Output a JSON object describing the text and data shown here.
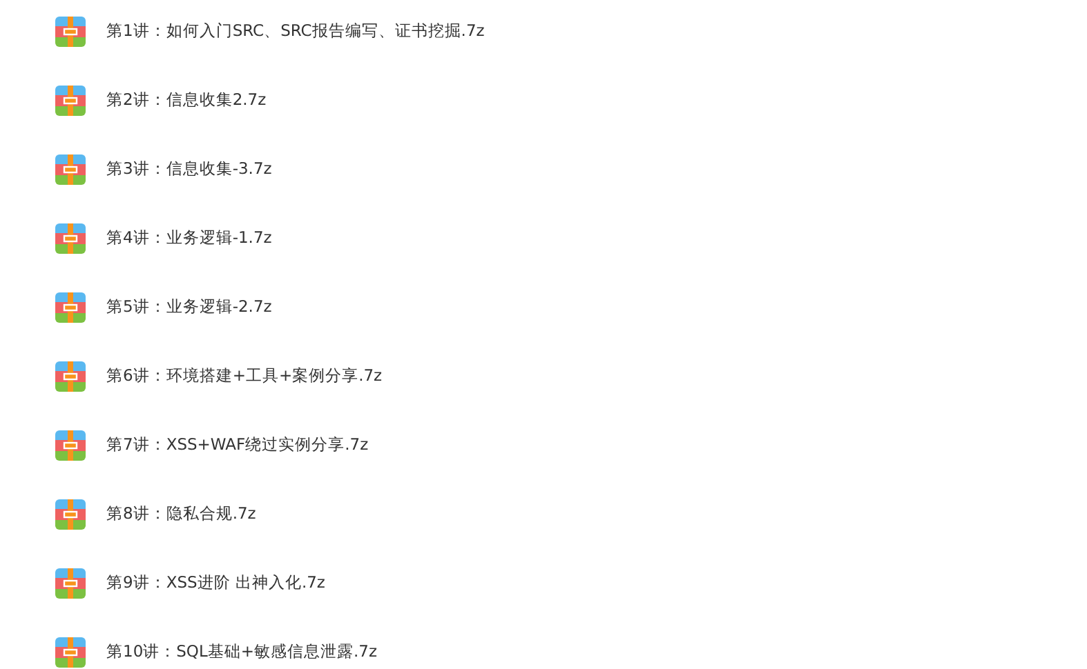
{
  "files": [
    {
      "name": "第1讲：如何入门SRC、SRC报告编写、证书挖掘.7z"
    },
    {
      "name": "第2讲：信息收集2.7z"
    },
    {
      "name": "第3讲：信息收集-3.7z"
    },
    {
      "name": "第4讲：业务逻辑-1.7z"
    },
    {
      "name": "第5讲：业务逻辑-2.7z"
    },
    {
      "name": "第6讲：环境搭建+工具+案例分享.7z"
    },
    {
      "name": "第7讲：XSS+WAF绕过实例分享.7z"
    },
    {
      "name": "第8讲：隐私合规.7z"
    },
    {
      "name": "第9讲：XSS进阶 出神入化.7z"
    },
    {
      "name": "第10讲：SQL基础+敏感信息泄露.7z"
    }
  ]
}
